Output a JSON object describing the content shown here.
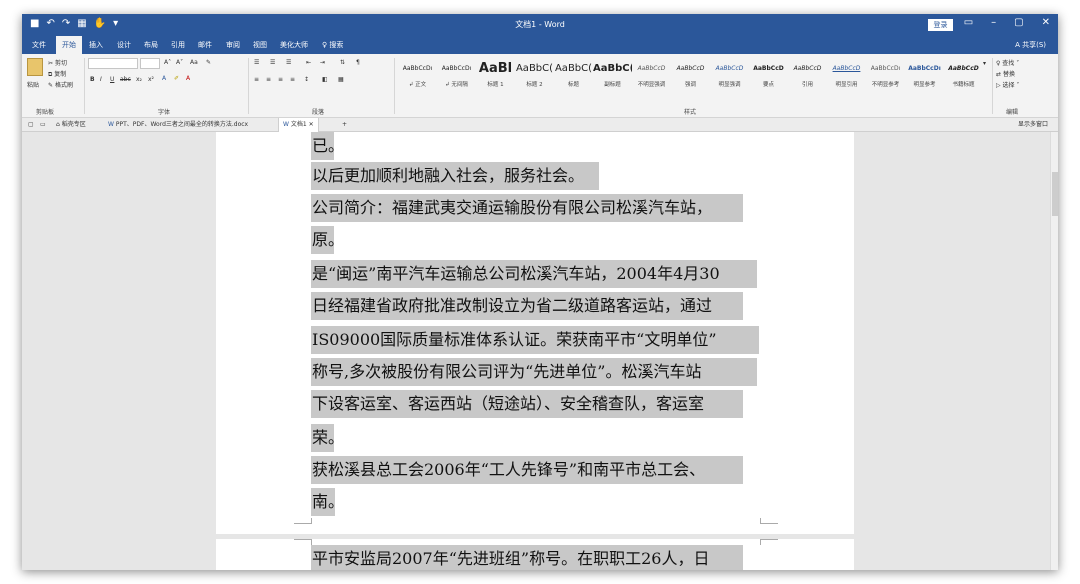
{
  "window": {
    "title": "文档1 - Word",
    "login": "登录",
    "qat_icons": [
      "save-icon",
      "undo-icon",
      "redo-icon",
      "format-icon",
      "touch-icon",
      "customize-icon"
    ],
    "controls": [
      "ribbon-display-icon",
      "minimize-icon",
      "maximize-icon",
      "close-icon"
    ]
  },
  "menu": {
    "items": [
      "文件",
      "开始",
      "插入",
      "设计",
      "布局",
      "引用",
      "邮件",
      "审阅",
      "视图",
      "美化大师",
      "♀ 搜索"
    ],
    "active": "开始",
    "share": "A 共享(S)"
  },
  "ribbon": {
    "clipboard": {
      "paste": "粘贴",
      "cut": "剪切",
      "copy": "复制",
      "format_painter": "格式刷",
      "label": "剪贴板"
    },
    "font": {
      "label": "字体",
      "bold": "B",
      "italic": "I",
      "underline": "U",
      "strike": "abc",
      "sub": "x₂",
      "sup": "x²",
      "grow": "A˄",
      "shrink": "A˅",
      "case": "Aa",
      "clear": "✎"
    },
    "paragraph": {
      "label": "段落"
    },
    "styles": {
      "label": "样式",
      "items": [
        {
          "sample": "AaBbCcDı",
          "name": "↲ 正文"
        },
        {
          "sample": "AaBbCcDı",
          "name": "↲ 无间隔"
        },
        {
          "sample": "AaBl",
          "name": "标题 1"
        },
        {
          "sample": "AaBbC(",
          "name": "标题 2"
        },
        {
          "sample": "AaBbC(",
          "name": "标题"
        },
        {
          "sample": "AaBbC(",
          "name": "副标题"
        },
        {
          "sample": "AaBbCcD",
          "name": "不明显强调"
        },
        {
          "sample": "AaBbCcD",
          "name": "强调"
        },
        {
          "sample": "AaBbCcD",
          "name": "明显强调"
        },
        {
          "sample": "AaBbCcD",
          "name": "要点"
        },
        {
          "sample": "AaBbCcD",
          "name": "引用"
        },
        {
          "sample": "AaBbCcD",
          "name": "明显引用"
        },
        {
          "sample": "AaBbCcDı",
          "name": "不明显参考"
        },
        {
          "sample": "AaBbCcDı",
          "name": "明显参考"
        },
        {
          "sample": "AaBbCcD",
          "name": "书籍标题"
        }
      ]
    },
    "editing": {
      "find": "♀ 查找 ˅",
      "replace": "替换",
      "select": "▷ 选择 ˅",
      "label": "编辑"
    }
  },
  "tabs": {
    "items": [
      "稻壳专区",
      "PPT、PDF、Word三者之间最全的转换方法.docx",
      "文档1"
    ],
    "right": "显示多窗口"
  },
  "document": {
    "lines": [
      "已。",
      "以后更加顺利地融入社会，服务社会。",
      "公司简介：福建武夷交通运输股份有限公司松溪汽车站，",
      "原。",
      "是“闽运”南平汽车运输总公司松溪汽车站，2004年4月30",
      "日经福建省政府批准改制设立为省二级道路客运站，通过",
      "IS09000国际质量标准体系认证。荣获南平市“文明单位”",
      "称号,多次被股份有限公司评为“先进单位”。松溪汽车站",
      "下设客运室、客运西站（短途站）、安全稽查队，客运室",
      "荣。",
      "获松溪县总工会2006年“工人先锋号”和南平市总工会、",
      "南。"
    ],
    "page2_line": "平市安监局2007年“先进班组”称号。在职职工26人，日"
  }
}
